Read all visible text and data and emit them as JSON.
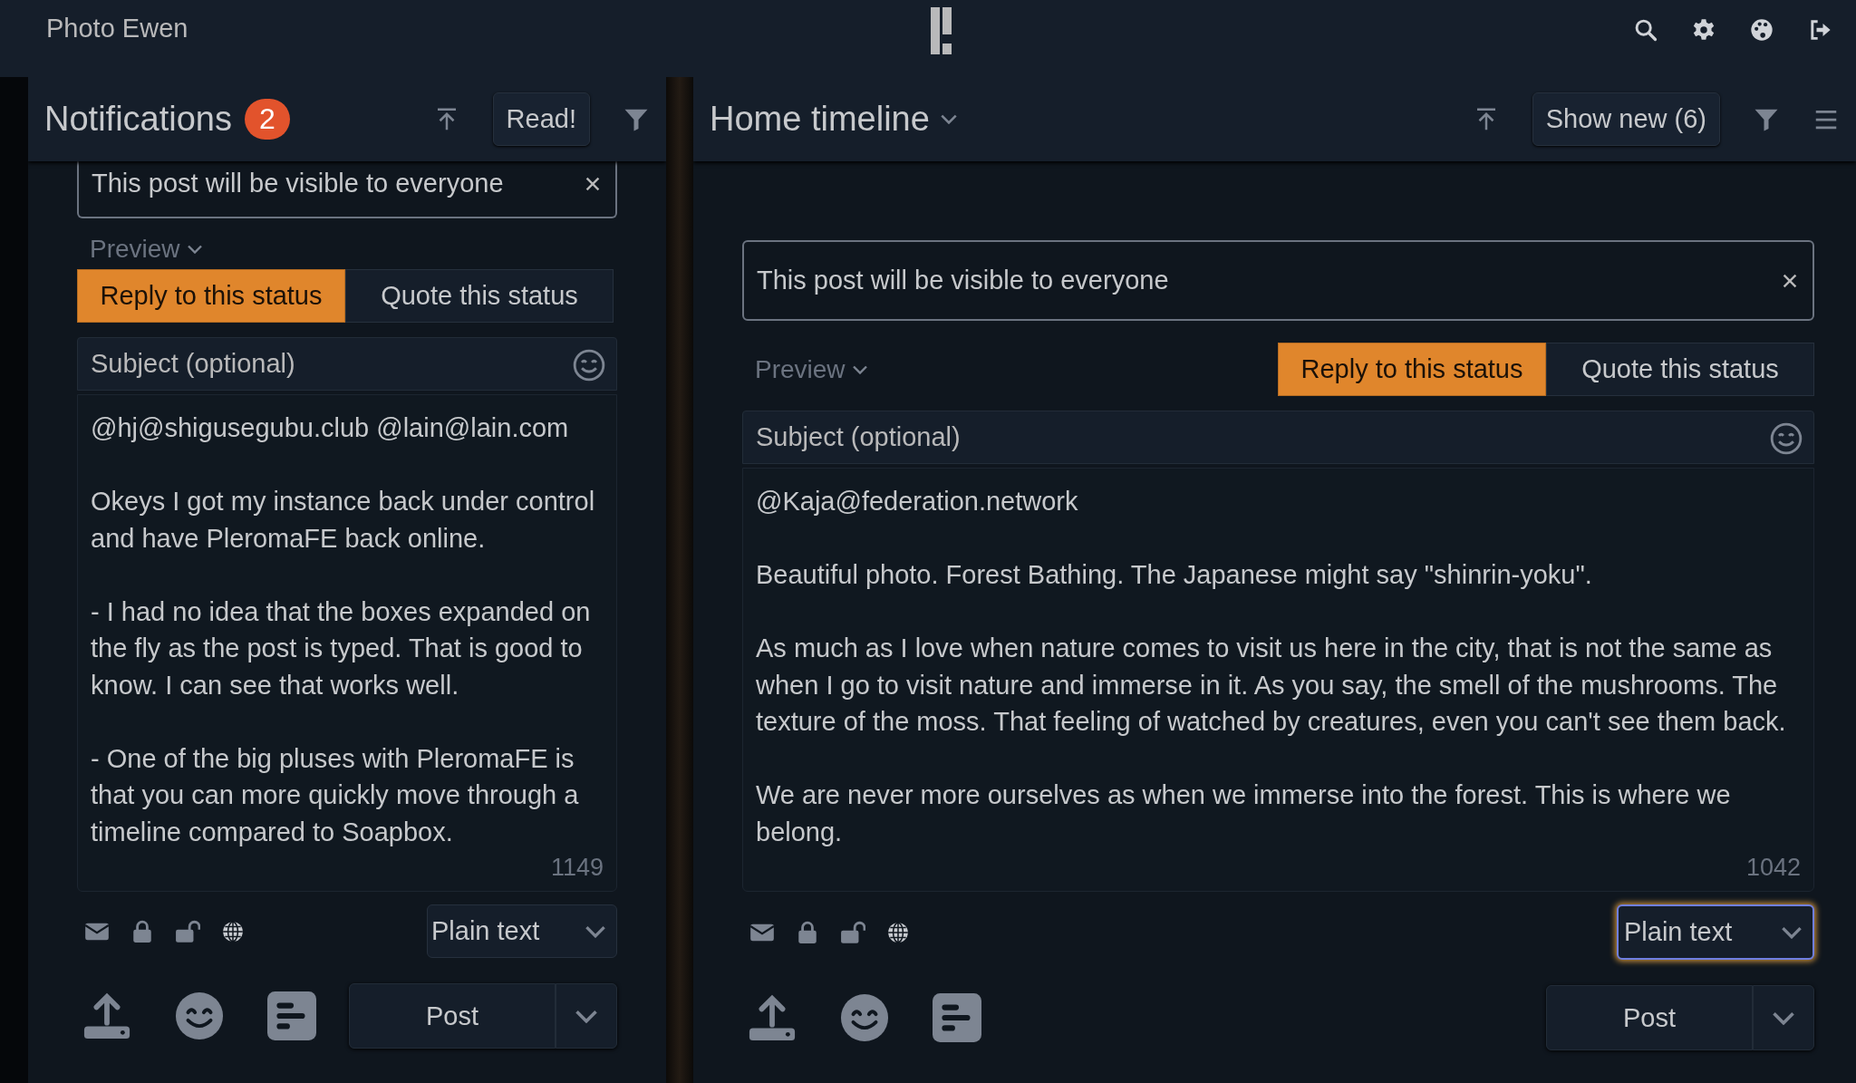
{
  "top_bar": {
    "title": "Photo Ewen"
  },
  "columns": [
    {
      "title": "Notifications",
      "badge": "2",
      "dropdown": false,
      "header_button": "Read!",
      "menu": false,
      "composer": {
        "notice": "This post will be visible to everyone",
        "preview": "Preview",
        "modes": [
          {
            "label": "Reply to this status",
            "selected": true
          },
          {
            "label": "Quote this status",
            "selected": false
          }
        ],
        "subject_placeholder": "Subject (optional)",
        "body": "@hj@shigusegubu.club @lain@lain.com\n\nOkeys I got my instance back under control and have PleromaFE back online.\n\n- I had no idea that the boxes expanded on the fly as the post is typed. That is good to know. I can see that works well.\n\n- One of the big pluses with PleromaFE is that you can more quickly move through a timeline compared to Soapbox.",
        "char_count": "1149",
        "format": "Plain text",
        "format_focused": false,
        "post": "Post"
      }
    },
    {
      "title": "Home timeline",
      "dropdown": true,
      "header_button": "Show new (6)",
      "menu": true,
      "composer": {
        "notice": "This post will be visible to everyone",
        "preview": "Preview",
        "modes": [
          {
            "label": "Reply to this status",
            "selected": true
          },
          {
            "label": "Quote this status",
            "selected": false
          }
        ],
        "subject_placeholder": "Subject (optional)",
        "body": "@Kaja@federation.network\n\nBeautiful photo. Forest Bathing. The Japanese might say \"shinrin-yoku\".\n\nAs much as I love when nature comes to visit us here in the city, that is not the same as when I go to visit nature and immerse in it. As you say, the smell of the mushrooms. The texture of the moss. That feeling of watched by creatures, even you can't see them back.\n\nWe are never more ourselves as when we immerse into the forest. This is where we belong.",
        "char_count": "1042",
        "format": "Plain text",
        "format_focused": true,
        "post": "Post"
      }
    }
  ]
}
